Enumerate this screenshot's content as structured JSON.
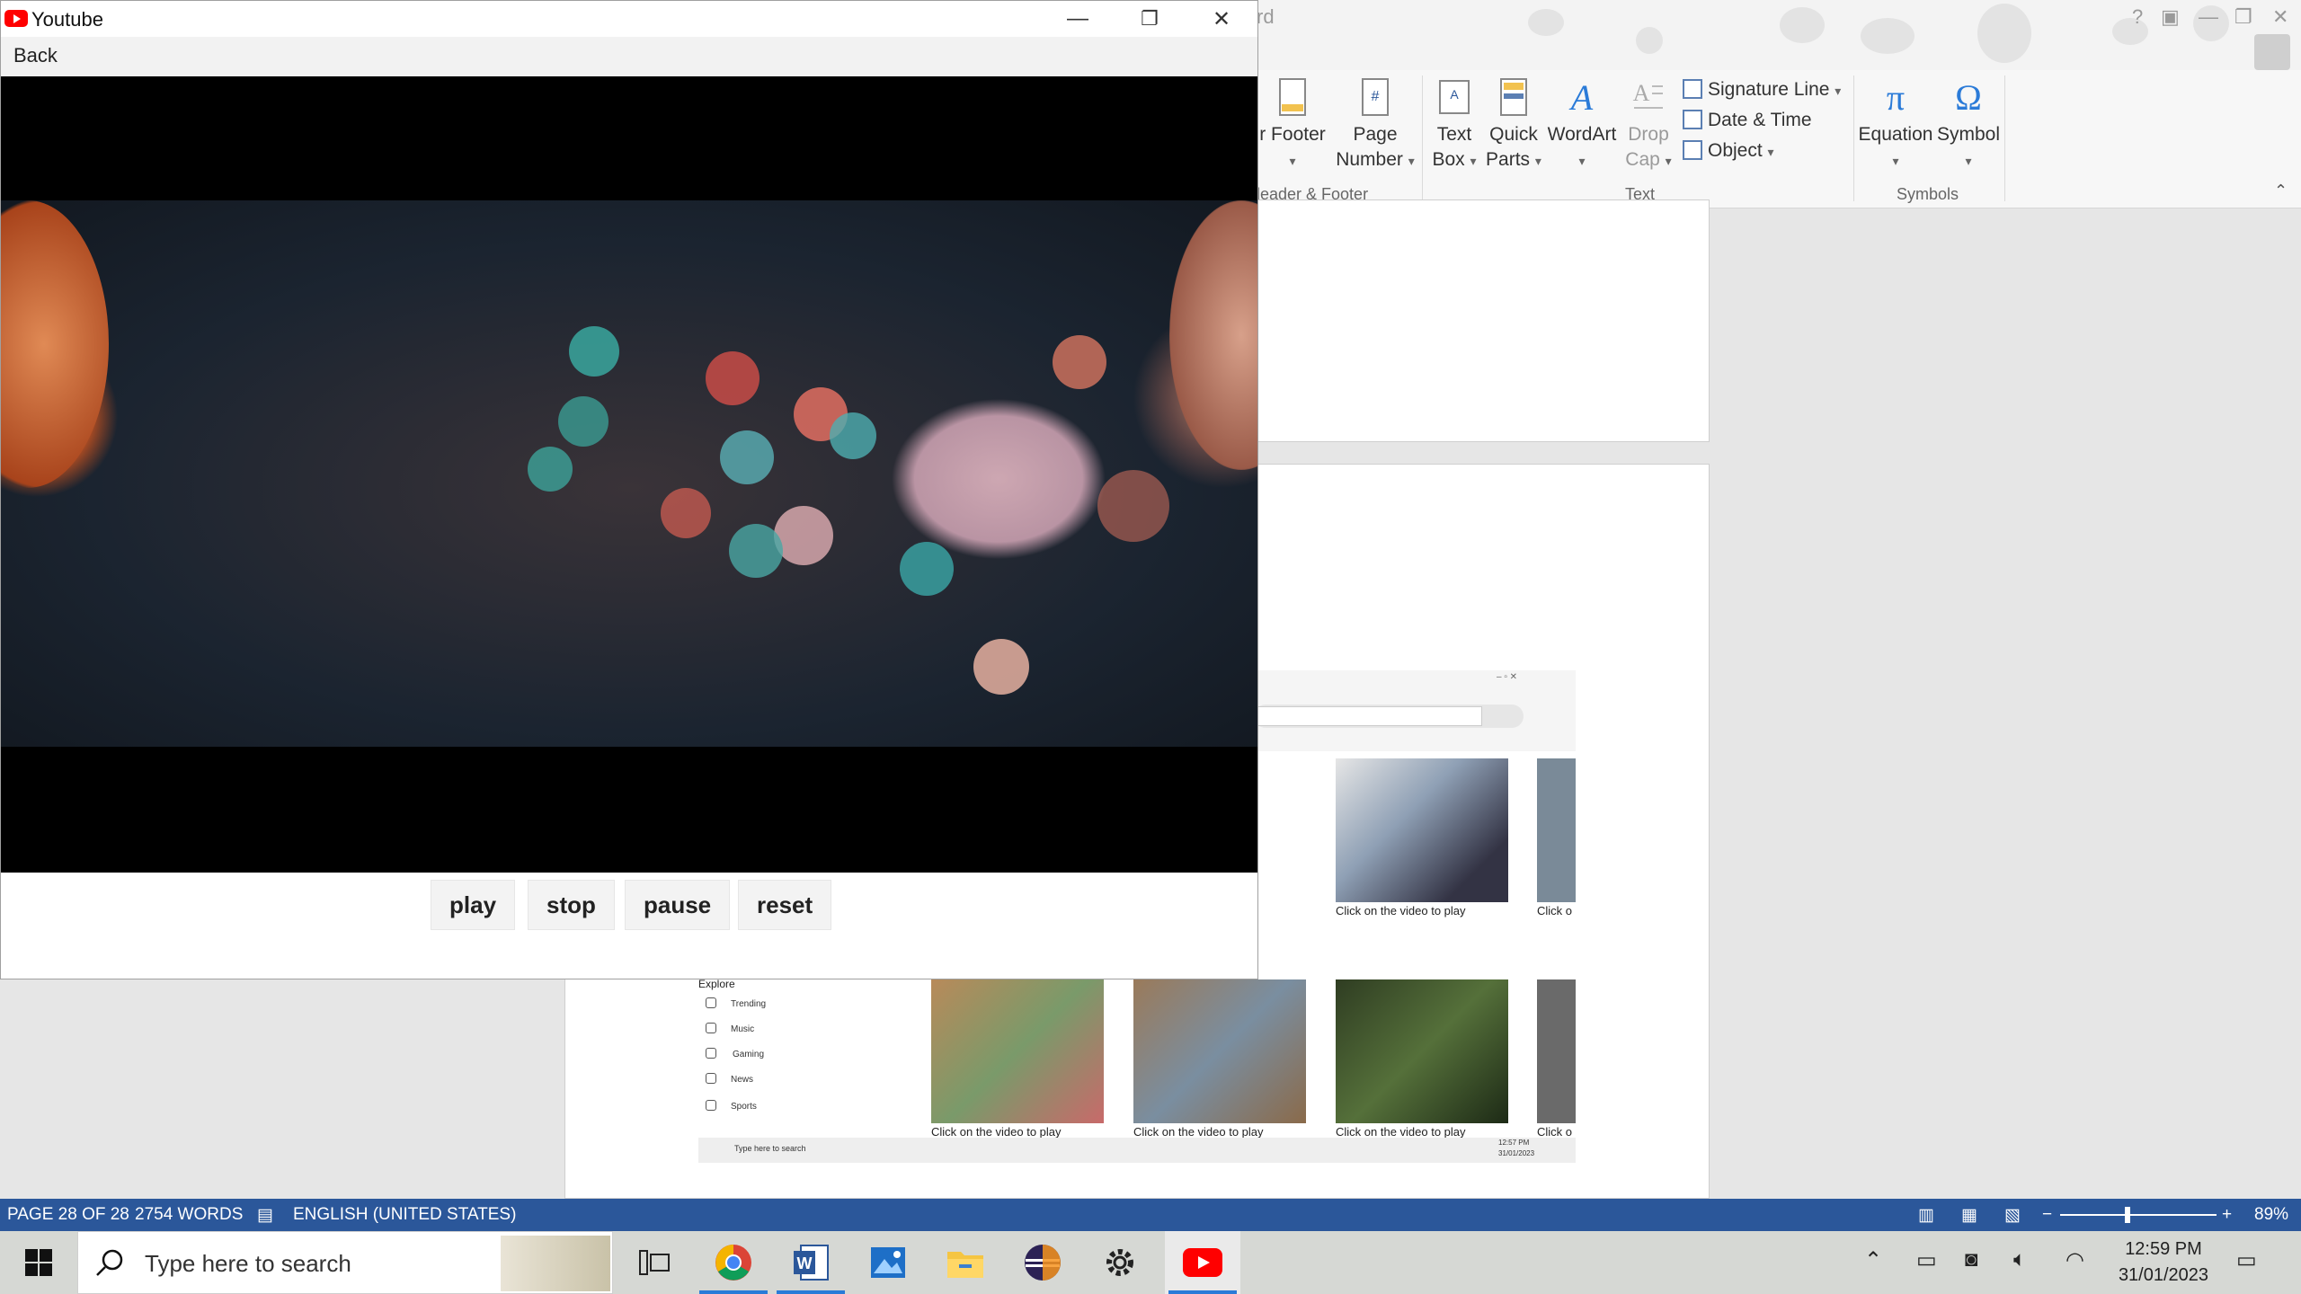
{
  "youtube_window": {
    "title": "Youtube",
    "back_label": "Back",
    "controls": {
      "play": "play",
      "stop": "stop",
      "pause": "pause",
      "reset": "reset"
    }
  },
  "word": {
    "title_fragment": "rd",
    "ribbon": {
      "header_footer": {
        "footer": "r Footer",
        "page_number_line1": "Page",
        "page_number_line2": "Number",
        "group_label": "leader & Footer"
      },
      "text": {
        "text_box_line1": "Text",
        "text_box_line2": "Box",
        "quick_parts_line1": "Quick",
        "quick_parts_line2": "Parts",
        "wordart": "WordArt",
        "drop_cap_line1": "Drop",
        "drop_cap_line2": "Cap",
        "signature_line": "Signature Line",
        "date_time": "Date & Time",
        "object": "Object",
        "group_label": "Text"
      },
      "symbols": {
        "equation": "Equation",
        "symbol": "Symbol",
        "group_label": "Symbols"
      }
    },
    "embedded_screenshot": {
      "captions": [
        "Click on the video to play",
        "Click o",
        "Click on the video to play",
        "Click on the video to play",
        "Click on the video to play",
        "Click o",
        "ay"
      ],
      "explore": {
        "heading": "Explore",
        "items": [
          "Trending",
          "Music",
          "Gaming",
          "News",
          "Sports"
        ]
      },
      "search_placeholder": "Type here to search",
      "clock_time": "12:57 PM",
      "clock_date": "31/01/2023"
    },
    "status": {
      "page": "PAGE 28 OF 28",
      "words": "2754 WORDS",
      "language": "ENGLISH (UNITED STATES)",
      "zoom": "89%"
    }
  },
  "taskbar": {
    "search_placeholder": "Type here to search",
    "time": "12:59 PM",
    "date": "31/01/2023"
  },
  "colors": {
    "word_status_bar": "#2b579a",
    "youtube_red": "#ff0000",
    "taskbar": "#d6d8d4"
  }
}
